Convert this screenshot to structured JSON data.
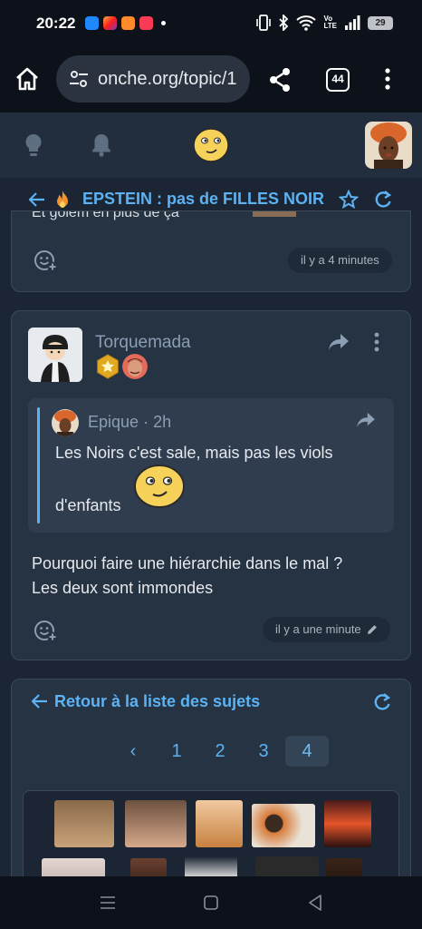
{
  "status_bar": {
    "time": "20:22",
    "battery": "29",
    "network": "Vo LTE"
  },
  "browser": {
    "url": "onche.org/topic/1",
    "tab_count": "44"
  },
  "topic": {
    "title": "EPSTEIN : pas de FILLES NOIR"
  },
  "previous_post": {
    "clipped_text": "Et golem en plus de ça",
    "time": "il y a 4 minutes"
  },
  "post": {
    "author": "Torquemada",
    "quote": {
      "author": "Epique",
      "time": "2h",
      "line1": "Les Noirs c'est sale, mais pas les viols",
      "line2": "d'enfants"
    },
    "body_line1": "Pourquoi faire une hiérarchie dans le mal ?",
    "body_line2": "Les deux sont immondes",
    "time": "il y a une minute"
  },
  "nav": {
    "back_label": "Retour à la liste des sujets",
    "pages": [
      "1",
      "2",
      "3",
      "4"
    ],
    "current_page": "4",
    "prev_symbol": "‹"
  },
  "colors": {
    "accent": "#5cb2f2",
    "background": "#1b2533",
    "card": "#263343",
    "author": "#8b9eb4"
  }
}
